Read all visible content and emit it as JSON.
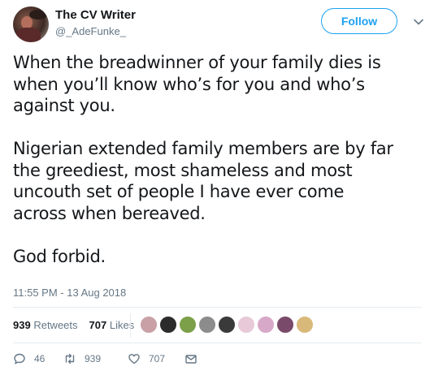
{
  "author": {
    "name": "The CV Writer",
    "handle": "@_AdeFunke_"
  },
  "follow_label": "Follow",
  "tweet_paragraphs": [
    "When the breadwinner of your family dies is\nwhen you’ll know who’s for you and who’s\nagainst you.",
    "Nigerian extended family members are by far\nthe greediest, most shameless and most\nuncouth set of people I have ever come\nacross when bereaved.",
    "God forbid."
  ],
  "timestamp": "11:55 PM - 13 Aug 2018",
  "stats": {
    "retweets_count": "939",
    "retweets_label": "Retweets",
    "likes_count": "707",
    "likes_label": "Likes"
  },
  "liker_avatar_colors": [
    "#c9a0a6",
    "#2b2b2b",
    "#7ca04a",
    "#8c8c8c",
    "#3a3a3a",
    "#e7c9d8",
    "#d7a8c8",
    "#7a4a6a",
    "#d9b97a"
  ],
  "actions": {
    "reply_count": "46",
    "retweet_count": "939",
    "like_count": "707"
  },
  "colors": {
    "accent": "#1da1f2",
    "secondary_text": "#657786"
  }
}
